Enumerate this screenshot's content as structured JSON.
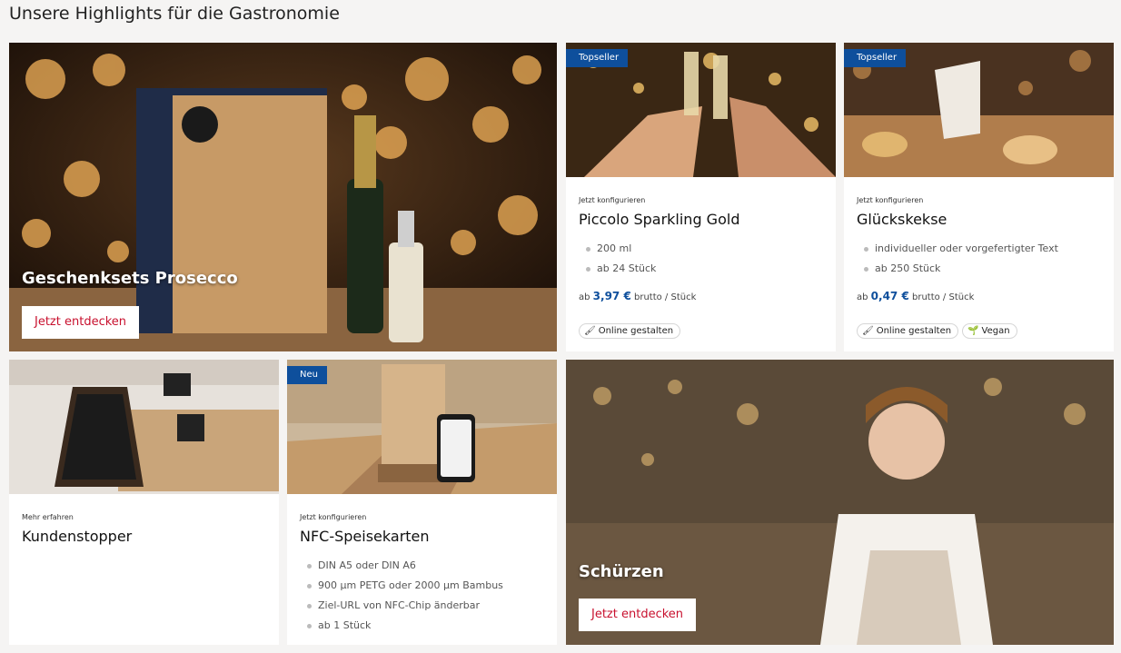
{
  "page": {
    "title": "Unsere Highlights für die Gastronomie"
  },
  "tiles": {
    "prosecco": {
      "title": "Geschenksets Prosecco",
      "cta": "Jetzt entdecken"
    },
    "piccolo": {
      "badge": "Topseller",
      "kicker": "Jetzt konfigurieren",
      "title": "Piccolo Sparkling Gold",
      "bullets": [
        "200 ml",
        "ab 24 Stück"
      ],
      "price_prefix": "ab",
      "price_value": "3,97 €",
      "price_suffix": "brutto / Stück",
      "chips": [
        {
          "icon": "brush-icon",
          "label": "Online gestalten"
        }
      ]
    },
    "kekse": {
      "badge": "Topseller",
      "kicker": "Jetzt konfigurieren",
      "title": "Glückskekse",
      "bullets": [
        "individueller oder vorgefertigter Text",
        "ab 250 Stück"
      ],
      "price_prefix": "ab",
      "price_value": "0,47 €",
      "price_suffix": "brutto / Stück",
      "chips": [
        {
          "icon": "brush-icon",
          "label": "Online gestalten"
        },
        {
          "icon": "leaf-icon",
          "label": "Vegan"
        }
      ]
    },
    "kundenstopper": {
      "kicker": "Mehr erfahren",
      "title": "Kundenstopper"
    },
    "nfc": {
      "badge": "Neu",
      "kicker": "Jetzt konfigurieren",
      "title": "NFC-Speisekarten",
      "bullets": [
        "DIN A5 oder DIN A6",
        "900 µm PETG oder 2000 µm Bambus",
        "Ziel-URL von NFC-Chip änderbar",
        "ab 1 Stück"
      ]
    },
    "schuerzen": {
      "title": "Schürzen",
      "cta": "Jetzt entdecken"
    }
  },
  "colors": {
    "accent_red": "#c8102e",
    "brand_blue": "#0e4f9c"
  }
}
